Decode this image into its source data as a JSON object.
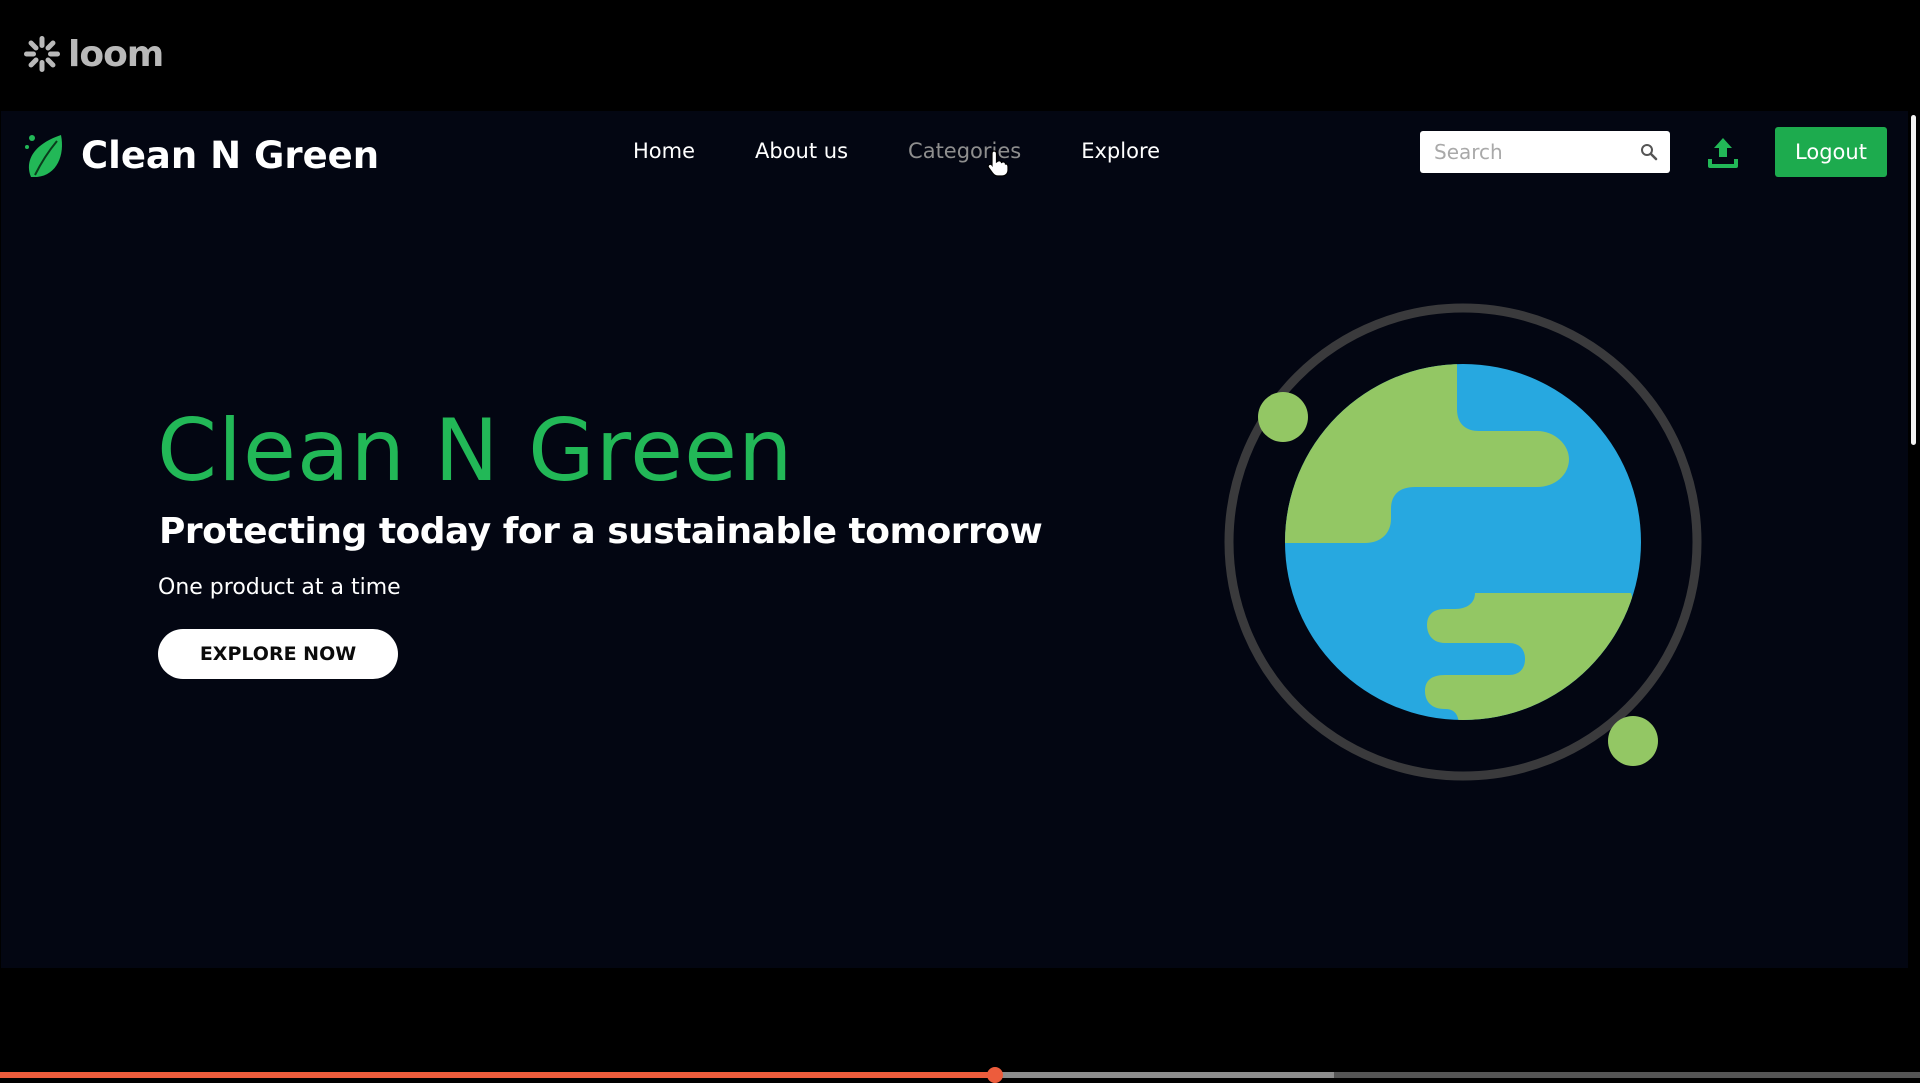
{
  "recorder": {
    "brand": "loom",
    "progress": 0.518,
    "buffered": 0.695
  },
  "site": {
    "brand_name": "Clean N Green",
    "nav": [
      {
        "label": "Home"
      },
      {
        "label": "About us"
      },
      {
        "label": "Categories"
      },
      {
        "label": "Explore"
      }
    ],
    "search": {
      "placeholder": "Search",
      "value": ""
    },
    "logout_label": "Logout"
  },
  "hero": {
    "title": "Clean N Green",
    "subtitle": "Protecting today for a sustainable tomorrow",
    "tagline": "One product at a time",
    "cta_label": "EXPLORE NOW"
  },
  "colors": {
    "brand_green": "#22b857",
    "button_green": "#1dab4e",
    "land_green": "#93c764",
    "ocean_blue": "#27a8e0",
    "background": "#030612",
    "progress": "#ed5c3c"
  },
  "icons": {
    "recorder_logo": "loom-asterisk-icon",
    "brand_logo": "leaf-icon",
    "search": "search-icon",
    "upload": "upload-icon",
    "illustration": "earth-illustration"
  }
}
